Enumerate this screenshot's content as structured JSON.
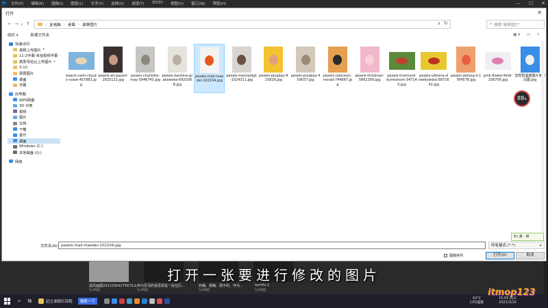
{
  "ps": {
    "logo": "Ps",
    "menu": [
      "文件(F)",
      "编辑(E)",
      "图像(I)",
      "图层(L)",
      "文字(Y)",
      "选择(S)",
      "滤镜(T)",
      "3D(D)",
      "视图(V)",
      "窗口(W)",
      "帮助(H)"
    ],
    "controls": [
      "—",
      "☐",
      "✕"
    ]
  },
  "dialog": {
    "title": "打开",
    "breadcrumb": [
      "此电脑",
      "桌面",
      "录屏图片"
    ],
    "search_placeholder": "搜索\"录屏图片\"",
    "toolbar": {
      "organize": "组织 ▾",
      "new_folder": "新建文件夹"
    },
    "nav": [
      {
        "label": "快速访问",
        "level": 1,
        "icon": "star",
        "color": "#2a7fd4",
        "pin": false
      },
      {
        "label": "视频上传图片",
        "level": 2,
        "icon": "folder",
        "color": "#e8c25a",
        "pin": true
      },
      {
        "label": "11-2字幕-未拍视频字幕",
        "level": 2,
        "icon": "folder",
        "color": "#e8c25a",
        "pin": true
      },
      {
        "label": "真爱母拍台上传图片",
        "level": 2,
        "icon": "folder",
        "color": "#e8c25a",
        "pin": true
      },
      {
        "label": "3-10",
        "level": 2,
        "icon": "folder",
        "color": "#e8c25a",
        "pin": false
      },
      {
        "label": "录屏图片",
        "level": 2,
        "icon": "folder",
        "color": "#e8c25a",
        "pin": false
      },
      {
        "label": "桌面",
        "level": 2,
        "icon": "folder",
        "color": "#3a8ee6",
        "pin": false
      },
      {
        "label": "字幕",
        "level": 2,
        "icon": "folder",
        "color": "#e8c25a",
        "pin": false
      },
      {
        "gap": true
      },
      {
        "label": "此电脑",
        "level": 1,
        "icon": "pc",
        "color": "#3a8ee6",
        "pin": false
      },
      {
        "label": "WPS网盘",
        "level": 2,
        "icon": "cloud",
        "color": "#3a8ee6",
        "pin": false
      },
      {
        "label": "3D 对象",
        "level": 2,
        "icon": "cube",
        "color": "#6aa8e6",
        "pin": false
      },
      {
        "label": "视频",
        "level": 2,
        "icon": "video",
        "color": "#6a6a9a",
        "pin": false
      },
      {
        "label": "图片",
        "level": 2,
        "icon": "image",
        "color": "#6aa8e6",
        "pin": false
      },
      {
        "label": "文档",
        "level": 2,
        "icon": "doc",
        "color": "#8a8a8a",
        "pin": false
      },
      {
        "label": "下载",
        "level": 2,
        "icon": "download",
        "color": "#3a8ee6",
        "pin": false
      },
      {
        "label": "音乐",
        "level": 2,
        "icon": "music",
        "color": "#3a8ee6",
        "pin": false
      },
      {
        "label": "桌面",
        "level": 2,
        "icon": "desktop",
        "color": "#3a8ee6",
        "pin": false,
        "selected": true
      },
      {
        "label": "Windows (C:)",
        "level": 2,
        "icon": "drive",
        "color": "#6a6a6a",
        "pin": false
      },
      {
        "label": "本地磁盘 (D:)",
        "level": 2,
        "icon": "drive",
        "color": "#6a6a6a",
        "pin": false
      },
      {
        "gap": true
      },
      {
        "label": "网络",
        "level": 1,
        "icon": "network",
        "color": "#3a8ee6",
        "pin": false
      }
    ],
    "files": [
      {
        "name": "beach-calm-clouds-coast-457881.jpg",
        "color": "#7fb4de",
        "accent": "#e8d7b4",
        "shape": "landscape"
      },
      {
        "name": "pexels-ali-pazani-2825122.jpg",
        "color": "#3a3030",
        "accent": "#c79a84",
        "shape": "portrait"
      },
      {
        "name": "pexels-charlotte-may-5946743.jpg",
        "color": "#c8c6c2",
        "accent": "#8a8680",
        "shape": "portrait"
      },
      {
        "name": "pexels-karolina-grabowska-6920368.jpg",
        "color": "#e6e2dc",
        "accent": "#b8aea2",
        "shape": "portrait"
      },
      {
        "name": "pexels-mali-maeder-102104.jpg",
        "color": "#f4f4f4",
        "accent": "#e8581c",
        "shape": "portrait",
        "selected": true
      },
      {
        "name": "pexels-mentatdgt-1024311.jpg",
        "color": "#d8d4d0",
        "accent": "#6a5040",
        "shape": "portrait"
      },
      {
        "name": "pexels-pixabay-415829.jpg",
        "color": "#f2c230",
        "accent": "#e0a080",
        "shape": "portrait"
      },
      {
        "name": "pexels-pixabay-459037.jpg",
        "color": "#d4c8b8",
        "accent": "#9a8a78",
        "shape": "portrait"
      },
      {
        "name": "pexels-rakicevic-nenad-744667.jpg",
        "color": "#e6a050",
        "accent": "#2a2a2a",
        "shape": "portrait"
      },
      {
        "name": "pexels-thirdman-5862309.jpg",
        "color": "#f0b8c8",
        "accent": "#f8d0da",
        "shape": "portrait"
      },
      {
        "name": "pexels-tirachard-kumtanom-347140.jpg",
        "color": "#5a8a3a",
        "accent": "#c04030",
        "shape": "landscape"
      },
      {
        "name": "pexels-viktoria-slowikowska-5871642.jpg",
        "color": "#e8c830",
        "accent": "#c03020",
        "shape": "landscape"
      },
      {
        "name": "pexels-zetong-li-1784578.jpg",
        "color": "#f0a070",
        "accent": "#e86040",
        "shape": "portrait"
      },
      {
        "name": "pink-flower-field-158756.jpg",
        "color": "#f0f0f4",
        "accent": "#e080b0",
        "shape": "landscape"
      },
      {
        "name": "怎样把温度图片变成白图.jpg",
        "color": "#3a8ee6",
        "accent": "#f0f0f0",
        "shape": "portrait"
      }
    ],
    "filename_label": "文件名(N):",
    "filename_value": "pexels-mali-maeder-102104.jpg",
    "filetype_value": "所有格式 (*.*)",
    "sequence_label": "图像序列",
    "open_label": "打开(O)",
    "cancel_label": "取消"
  },
  "overlay": {
    "cpu_value": "88",
    "cpu_unit": "%",
    "cpu_temp": "42°C",
    "cpu_temp_label": "CPU温度",
    "ime": "En 奥 · 简",
    "subtitle": "打开一张要进行修改的图片"
  },
  "background_items": [
    {
      "caption": "鼠风画图20210304275670.b...",
      "time": "5小时前"
    },
    {
      "caption": "作为否词的看思想是一段往历...",
      "time": "5小时前"
    },
    {
      "caption": "奶糊、朋糊、便不利、作为...",
      "time": "5小时前"
    },
    {
      "caption": "terrific-1",
      "time": "5小时前"
    }
  ],
  "taskbar": {
    "app_label": "赶立录颜红双鞋",
    "tag": "搜索一下",
    "temp": "42°C",
    "temp_label": "CPU温度",
    "time": "15:55 周三",
    "date": "2021/3/10",
    "watermark": "itmop123"
  }
}
